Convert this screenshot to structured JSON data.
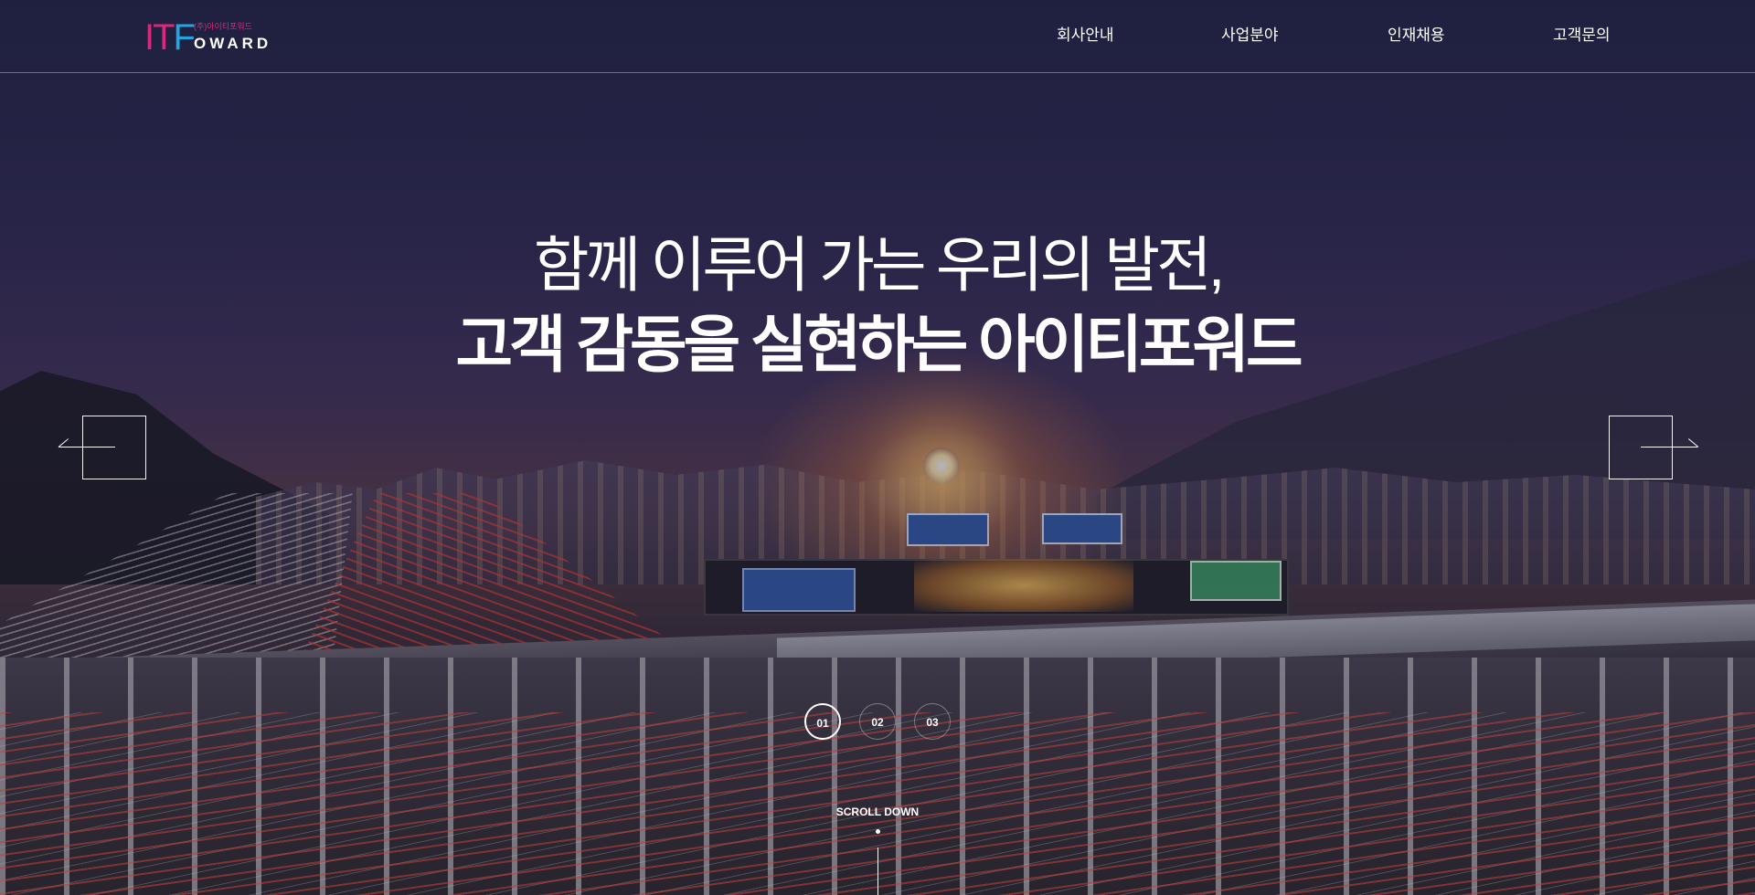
{
  "brand": {
    "logo_main": "IT",
    "logo_f": "F",
    "logo_sub": "(주)아이티포워드",
    "logo_word": "OWARD",
    "colors": {
      "magenta": "#d9297c",
      "blue": "#1fa6e3"
    }
  },
  "nav": {
    "items": [
      {
        "label": "회사안내"
      },
      {
        "label": "사업분야"
      },
      {
        "label": "인재채용"
      },
      {
        "label": "고객문의"
      }
    ]
  },
  "hero": {
    "headline_light": "함께 이루어 가는 우리의 발전,",
    "headline_bold": "고객 감동을 실현하는 아이티포워드",
    "prev_icon": "arrow-left-icon",
    "next_icon": "arrow-right-icon"
  },
  "pager": {
    "pages": [
      "01",
      "02",
      "03"
    ],
    "active_index": 0
  },
  "scroll": {
    "label": "SCROLL DOWN"
  }
}
